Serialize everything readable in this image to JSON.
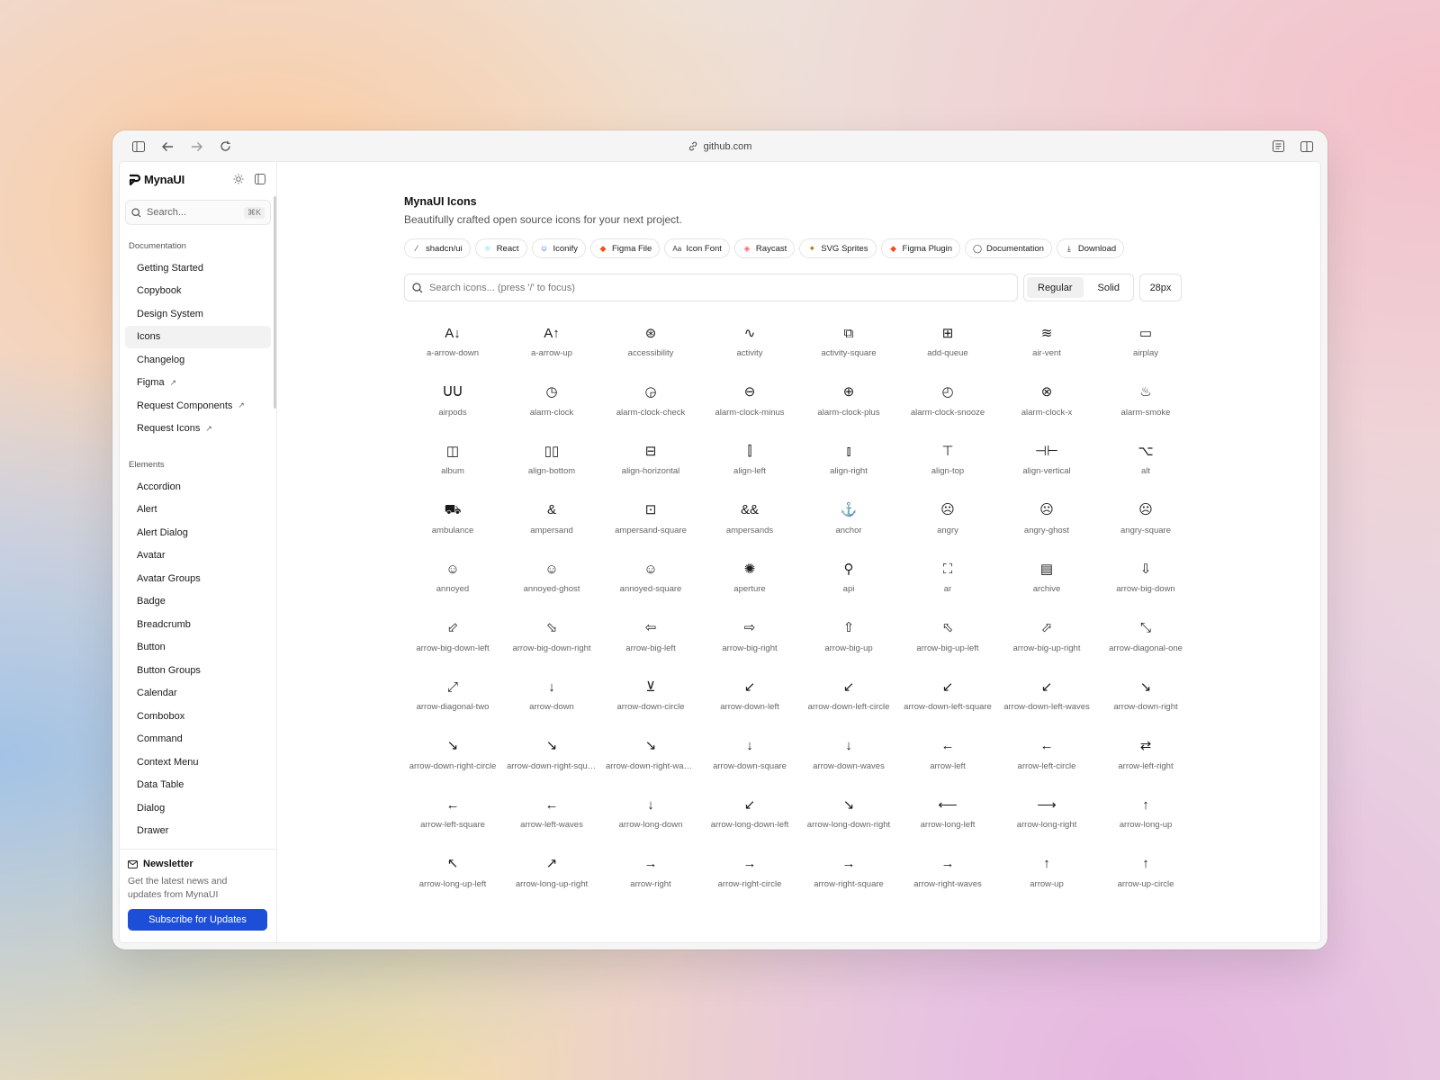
{
  "browser": {
    "url": "github.com",
    "icons": {
      "sidebar_toggle": "sidebar-icon",
      "back": "arrow-left-icon",
      "forward": "arrow-right-icon",
      "reload": "reload-icon",
      "reader": "reader-icon",
      "split": "split-view-icon"
    }
  },
  "sidebar": {
    "brand": "MynaUI",
    "search": {
      "placeholder": "Search...",
      "shortcut": "⌘K"
    },
    "sections": [
      {
        "title": "Documentation",
        "items": [
          {
            "label": "Getting Started",
            "external": false
          },
          {
            "label": "Copybook",
            "external": false
          },
          {
            "label": "Design System",
            "external": false
          },
          {
            "label": "Icons",
            "external": false,
            "active": true
          },
          {
            "label": "Changelog",
            "external": false
          },
          {
            "label": "Figma",
            "external": true
          },
          {
            "label": "Request Components",
            "external": true
          },
          {
            "label": "Request Icons",
            "external": true
          }
        ]
      },
      {
        "title": "Elements",
        "items": [
          {
            "label": "Accordion"
          },
          {
            "label": "Alert"
          },
          {
            "label": "Alert Dialog"
          },
          {
            "label": "Avatar"
          },
          {
            "label": "Avatar Groups"
          },
          {
            "label": "Badge"
          },
          {
            "label": "Breadcrumb"
          },
          {
            "label": "Button"
          },
          {
            "label": "Button Groups"
          },
          {
            "label": "Calendar"
          },
          {
            "label": "Combobox"
          },
          {
            "label": "Command"
          },
          {
            "label": "Context Menu"
          },
          {
            "label": "Data Table"
          },
          {
            "label": "Dialog"
          },
          {
            "label": "Drawer"
          }
        ]
      }
    ],
    "newsletter": {
      "title": "Newsletter",
      "description": "Get the latest news and updates from MynaUI",
      "button": "Subscribe for Updates"
    }
  },
  "main": {
    "title": "MynaUI Icons",
    "subtitle": "Beautifully crafted open source icons for your next project.",
    "chips": [
      {
        "label": "shadcn/ui",
        "icon": "slash-icon"
      },
      {
        "label": "React",
        "icon": "react-icon"
      },
      {
        "label": "Iconify",
        "icon": "smile-icon"
      },
      {
        "label": "Figma File",
        "icon": "figma-icon"
      },
      {
        "label": "Icon Font",
        "icon": "font-icon"
      },
      {
        "label": "Raycast",
        "icon": "raycast-icon"
      },
      {
        "label": "SVG Sprites",
        "icon": "sprite-icon"
      },
      {
        "label": "Figma Plugin",
        "icon": "figma-icon"
      },
      {
        "label": "Documentation",
        "icon": "github-icon"
      },
      {
        "label": "Download",
        "icon": "download-icon"
      }
    ],
    "icon_search": {
      "placeholder": "Search icons... (press '/' to focus)"
    },
    "styles": [
      "Regular",
      "Solid"
    ],
    "active_style": "Regular",
    "size": "28px",
    "icons": [
      {
        "name": "a-arrow-down",
        "glyph": "A↓"
      },
      {
        "name": "a-arrow-up",
        "glyph": "A↑"
      },
      {
        "name": "accessibility",
        "glyph": "⊛"
      },
      {
        "name": "activity",
        "glyph": "∿"
      },
      {
        "name": "activity-square",
        "glyph": "⧉"
      },
      {
        "name": "add-queue",
        "glyph": "⊞"
      },
      {
        "name": "air-vent",
        "glyph": "≋"
      },
      {
        "name": "airplay",
        "glyph": "▭"
      },
      {
        "name": "airpods",
        "glyph": "ᑌᑌ"
      },
      {
        "name": "alarm-clock",
        "glyph": "◷"
      },
      {
        "name": "alarm-clock-check",
        "glyph": "◶"
      },
      {
        "name": "alarm-clock-minus",
        "glyph": "⊖"
      },
      {
        "name": "alarm-clock-plus",
        "glyph": "⊕"
      },
      {
        "name": "alarm-clock-snooze",
        "glyph": "◴"
      },
      {
        "name": "alarm-clock-x",
        "glyph": "⊗"
      },
      {
        "name": "alarm-smoke",
        "glyph": "♨"
      },
      {
        "name": "album",
        "glyph": "◫"
      },
      {
        "name": "align-bottom",
        "glyph": "▯▯"
      },
      {
        "name": "align-horizontal",
        "glyph": "⊟"
      },
      {
        "name": "align-left",
        "glyph": "⫿"
      },
      {
        "name": "align-right",
        "glyph": "⫾"
      },
      {
        "name": "align-top",
        "glyph": "⊤"
      },
      {
        "name": "align-vertical",
        "glyph": "⊣⊢"
      },
      {
        "name": "alt",
        "glyph": "⌥"
      },
      {
        "name": "ambulance",
        "glyph": "⛟"
      },
      {
        "name": "ampersand",
        "glyph": "&"
      },
      {
        "name": "ampersand-square",
        "glyph": "⊡"
      },
      {
        "name": "ampersands",
        "glyph": "&&"
      },
      {
        "name": "anchor",
        "glyph": "⚓"
      },
      {
        "name": "angry",
        "glyph": "☹"
      },
      {
        "name": "angry-ghost",
        "glyph": "☹"
      },
      {
        "name": "angry-square",
        "glyph": "☹"
      },
      {
        "name": "annoyed",
        "glyph": "☺"
      },
      {
        "name": "annoyed-ghost",
        "glyph": "☺"
      },
      {
        "name": "annoyed-square",
        "glyph": "☺"
      },
      {
        "name": "aperture",
        "glyph": "✺"
      },
      {
        "name": "api",
        "glyph": "⚲"
      },
      {
        "name": "ar",
        "glyph": "⛶"
      },
      {
        "name": "archive",
        "glyph": "▤"
      },
      {
        "name": "arrow-big-down",
        "glyph": "⇩"
      },
      {
        "name": "arrow-big-down-left",
        "glyph": "⬃"
      },
      {
        "name": "arrow-big-down-right",
        "glyph": "⬂"
      },
      {
        "name": "arrow-big-left",
        "glyph": "⇦"
      },
      {
        "name": "arrow-big-right",
        "glyph": "⇨"
      },
      {
        "name": "arrow-big-up",
        "glyph": "⇧"
      },
      {
        "name": "arrow-big-up-left",
        "glyph": "⬁"
      },
      {
        "name": "arrow-big-up-right",
        "glyph": "⬀"
      },
      {
        "name": "arrow-diagonal-one",
        "glyph": "⤡"
      },
      {
        "name": "arrow-diagonal-two",
        "glyph": "⤢"
      },
      {
        "name": "arrow-down",
        "glyph": "↓"
      },
      {
        "name": "arrow-down-circle",
        "glyph": "⊻"
      },
      {
        "name": "arrow-down-left",
        "glyph": "↙"
      },
      {
        "name": "arrow-down-left-circle",
        "glyph": "↙"
      },
      {
        "name": "arrow-down-left-square",
        "glyph": "↙"
      },
      {
        "name": "arrow-down-left-waves",
        "glyph": "↙"
      },
      {
        "name": "arrow-down-right",
        "glyph": "↘"
      },
      {
        "name": "arrow-down-right-circle",
        "glyph": "↘"
      },
      {
        "name": "arrow-down-right-square",
        "glyph": "↘"
      },
      {
        "name": "arrow-down-right-waves",
        "glyph": "↘"
      },
      {
        "name": "arrow-down-square",
        "glyph": "↓"
      },
      {
        "name": "arrow-down-waves",
        "glyph": "↓"
      },
      {
        "name": "arrow-left",
        "glyph": "←"
      },
      {
        "name": "arrow-left-circle",
        "glyph": "←"
      },
      {
        "name": "arrow-left-right",
        "glyph": "⇄"
      },
      {
        "name": "arrow-left-square",
        "glyph": "←"
      },
      {
        "name": "arrow-left-waves",
        "glyph": "←"
      },
      {
        "name": "arrow-long-down",
        "glyph": "↓"
      },
      {
        "name": "arrow-long-down-left",
        "glyph": "↙"
      },
      {
        "name": "arrow-long-down-right",
        "glyph": "↘"
      },
      {
        "name": "arrow-long-left",
        "glyph": "⟵"
      },
      {
        "name": "arrow-long-right",
        "glyph": "⟶"
      },
      {
        "name": "arrow-long-up",
        "glyph": "↑"
      },
      {
        "name": "arrow-long-up-left",
        "glyph": "↖"
      },
      {
        "name": "arrow-long-up-right",
        "glyph": "↗"
      },
      {
        "name": "arrow-right",
        "glyph": "→"
      },
      {
        "name": "arrow-right-circle",
        "glyph": "→"
      },
      {
        "name": "arrow-right-square",
        "glyph": "→"
      },
      {
        "name": "arrow-right-waves",
        "glyph": "→"
      },
      {
        "name": "arrow-up",
        "glyph": "↑"
      },
      {
        "name": "arrow-up-circle",
        "glyph": "↑"
      }
    ]
  }
}
